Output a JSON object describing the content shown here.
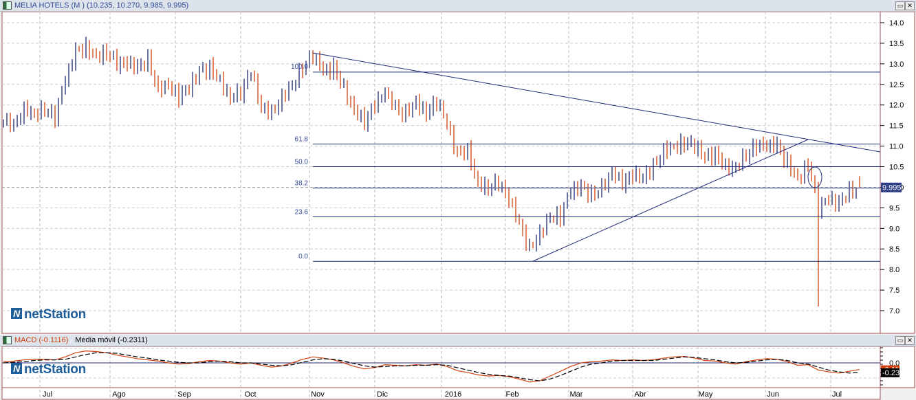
{
  "title": "MELIA HOTELS (M ) (10.235, 10.270, 9.985, 9.995)",
  "macd_title": {
    "macd": "MACD (-0.1116)",
    "sep": " - ",
    "signal": "Media móvil (-0.2311)"
  },
  "logo": "netStation",
  "buttons": {
    "restore": "▭",
    "close": "✕"
  },
  "colors": {
    "up": "#1e2a78",
    "down": "#d0410f",
    "line": "#1e2a78",
    "macd": "#d0410f",
    "signal": "#000000",
    "price_tag": "#2d3e84"
  },
  "chart_data": [
    {
      "type": "ohlc",
      "title": "MELIA HOTELS (M )",
      "last": {
        "open": 10.235,
        "high": 10.27,
        "low": 9.985,
        "close": 9.995
      },
      "price_label": "9.995",
      "ylim": [
        6.5,
        14.3
      ],
      "yticks": [
        "14.0",
        "13.5",
        "13.0",
        "12.5",
        "12.0",
        "11.5",
        "11.0",
        "10.5",
        "10.0",
        "9.5",
        "9.0",
        "8.5",
        "8.0",
        "7.5",
        "7.0"
      ],
      "xticks": [
        "Jul",
        "Ago",
        "Sep",
        "Oct",
        "Nov",
        "Dic",
        "2016",
        "Feb",
        "Mar",
        "Abr",
        "May",
        "Jun",
        "Jul"
      ],
      "closes": [
        11.6,
        11.5,
        11.9,
        11.8,
        11.9,
        11.7,
        12.6,
        13.3,
        13.4,
        13.2,
        13.3,
        13.0,
        13.0,
        12.9,
        13.1,
        12.4,
        12.5,
        12.2,
        12.4,
        12.8,
        12.9,
        12.6,
        12.2,
        12.3,
        12.8,
        11.9,
        11.8,
        12.2,
        12.5,
        12.9,
        13.2,
        12.8,
        12.9,
        12.4,
        11.9,
        11.6,
        12.0,
        12.3,
        11.9,
        11.8,
        12.1,
        11.8,
        12.1,
        11.5,
        10.8,
        10.9,
        10.1,
        10.0,
        10.1,
        9.7,
        9.1,
        8.5,
        8.9,
        9.3,
        9.3,
        9.9,
        10.0,
        9.8,
        10.0,
        10.4,
        10.1,
        10.3,
        10.2,
        10.5,
        10.9,
        11.0,
        11.1,
        11.0,
        10.7,
        10.8,
        10.5,
        10.5,
        10.8,
        11.0,
        11.0,
        11.0,
        10.6,
        10.2,
        10.6,
        9.5,
        9.7,
        9.6,
        9.9,
        10.0
      ],
      "spike_low": {
        "index": 79,
        "value": 7.1
      },
      "fibonacci": [
        {
          "label": "100.0",
          "value": 12.8
        },
        {
          "label": "61.8",
          "value": 11.05
        },
        {
          "label": "50.0",
          "value": 10.5
        },
        {
          "label": "38.2",
          "value": 9.98
        },
        {
          "label": "23.6",
          "value": 9.28
        },
        {
          "label": "0.0",
          "value": 8.2
        }
      ]
    },
    {
      "type": "line",
      "title": "MACD",
      "yticks": [
        "0.0"
      ],
      "ylim": [
        -0.4,
        0.3
      ],
      "series": [
        {
          "name": "MACD",
          "label": "-0.11",
          "values": [
            0.02,
            0.03,
            0.05,
            0.06,
            0.06,
            0.05,
            0.1,
            0.17,
            0.2,
            0.19,
            0.17,
            0.13,
            0.1,
            0.07,
            0.05,
            0.03,
            0.0,
            -0.02,
            -0.01,
            0.02,
            0.04,
            0.03,
            0.0,
            -0.02,
            0.0,
            -0.04,
            -0.07,
            -0.05,
            0.0,
            0.06,
            0.1,
            0.08,
            0.05,
            0.0,
            -0.06,
            -0.1,
            -0.08,
            -0.03,
            -0.04,
            -0.05,
            -0.03,
            -0.04,
            -0.02,
            -0.06,
            -0.13,
            -0.16,
            -0.2,
            -0.22,
            -0.21,
            -0.23,
            -0.27,
            -0.32,
            -0.3,
            -0.22,
            -0.14,
            -0.06,
            0.0,
            0.02,
            0.03,
            0.05,
            0.04,
            0.05,
            0.04,
            0.05,
            0.08,
            0.1,
            0.11,
            0.08,
            0.04,
            0.03,
            0.0,
            -0.02,
            0.02,
            0.05,
            0.07,
            0.06,
            0.02,
            -0.04,
            -0.03,
            -0.12,
            -0.15,
            -0.17,
            -0.14,
            -0.11
          ]
        },
        {
          "name": "Media móvil",
          "label": "-0.23",
          "values": [
            0.0,
            0.01,
            0.02,
            0.04,
            0.05,
            0.05,
            0.06,
            0.1,
            0.14,
            0.17,
            0.17,
            0.16,
            0.13,
            0.1,
            0.08,
            0.05,
            0.03,
            0.01,
            0.0,
            0.0,
            0.02,
            0.03,
            0.02,
            0.0,
            0.0,
            -0.02,
            -0.04,
            -0.05,
            -0.03,
            0.01,
            0.05,
            0.07,
            0.06,
            0.03,
            -0.01,
            -0.05,
            -0.07,
            -0.06,
            -0.05,
            -0.05,
            -0.04,
            -0.04,
            -0.03,
            -0.04,
            -0.08,
            -0.12,
            -0.16,
            -0.19,
            -0.21,
            -0.22,
            -0.25,
            -0.28,
            -0.3,
            -0.27,
            -0.21,
            -0.14,
            -0.07,
            -0.02,
            0.0,
            0.03,
            0.04,
            0.04,
            0.04,
            0.04,
            0.06,
            0.08,
            0.1,
            0.09,
            0.07,
            0.05,
            0.02,
            0.0,
            0.01,
            0.03,
            0.05,
            0.06,
            0.04,
            0.0,
            -0.02,
            -0.07,
            -0.12,
            -0.15,
            -0.17,
            -0.16
          ]
        }
      ]
    }
  ]
}
